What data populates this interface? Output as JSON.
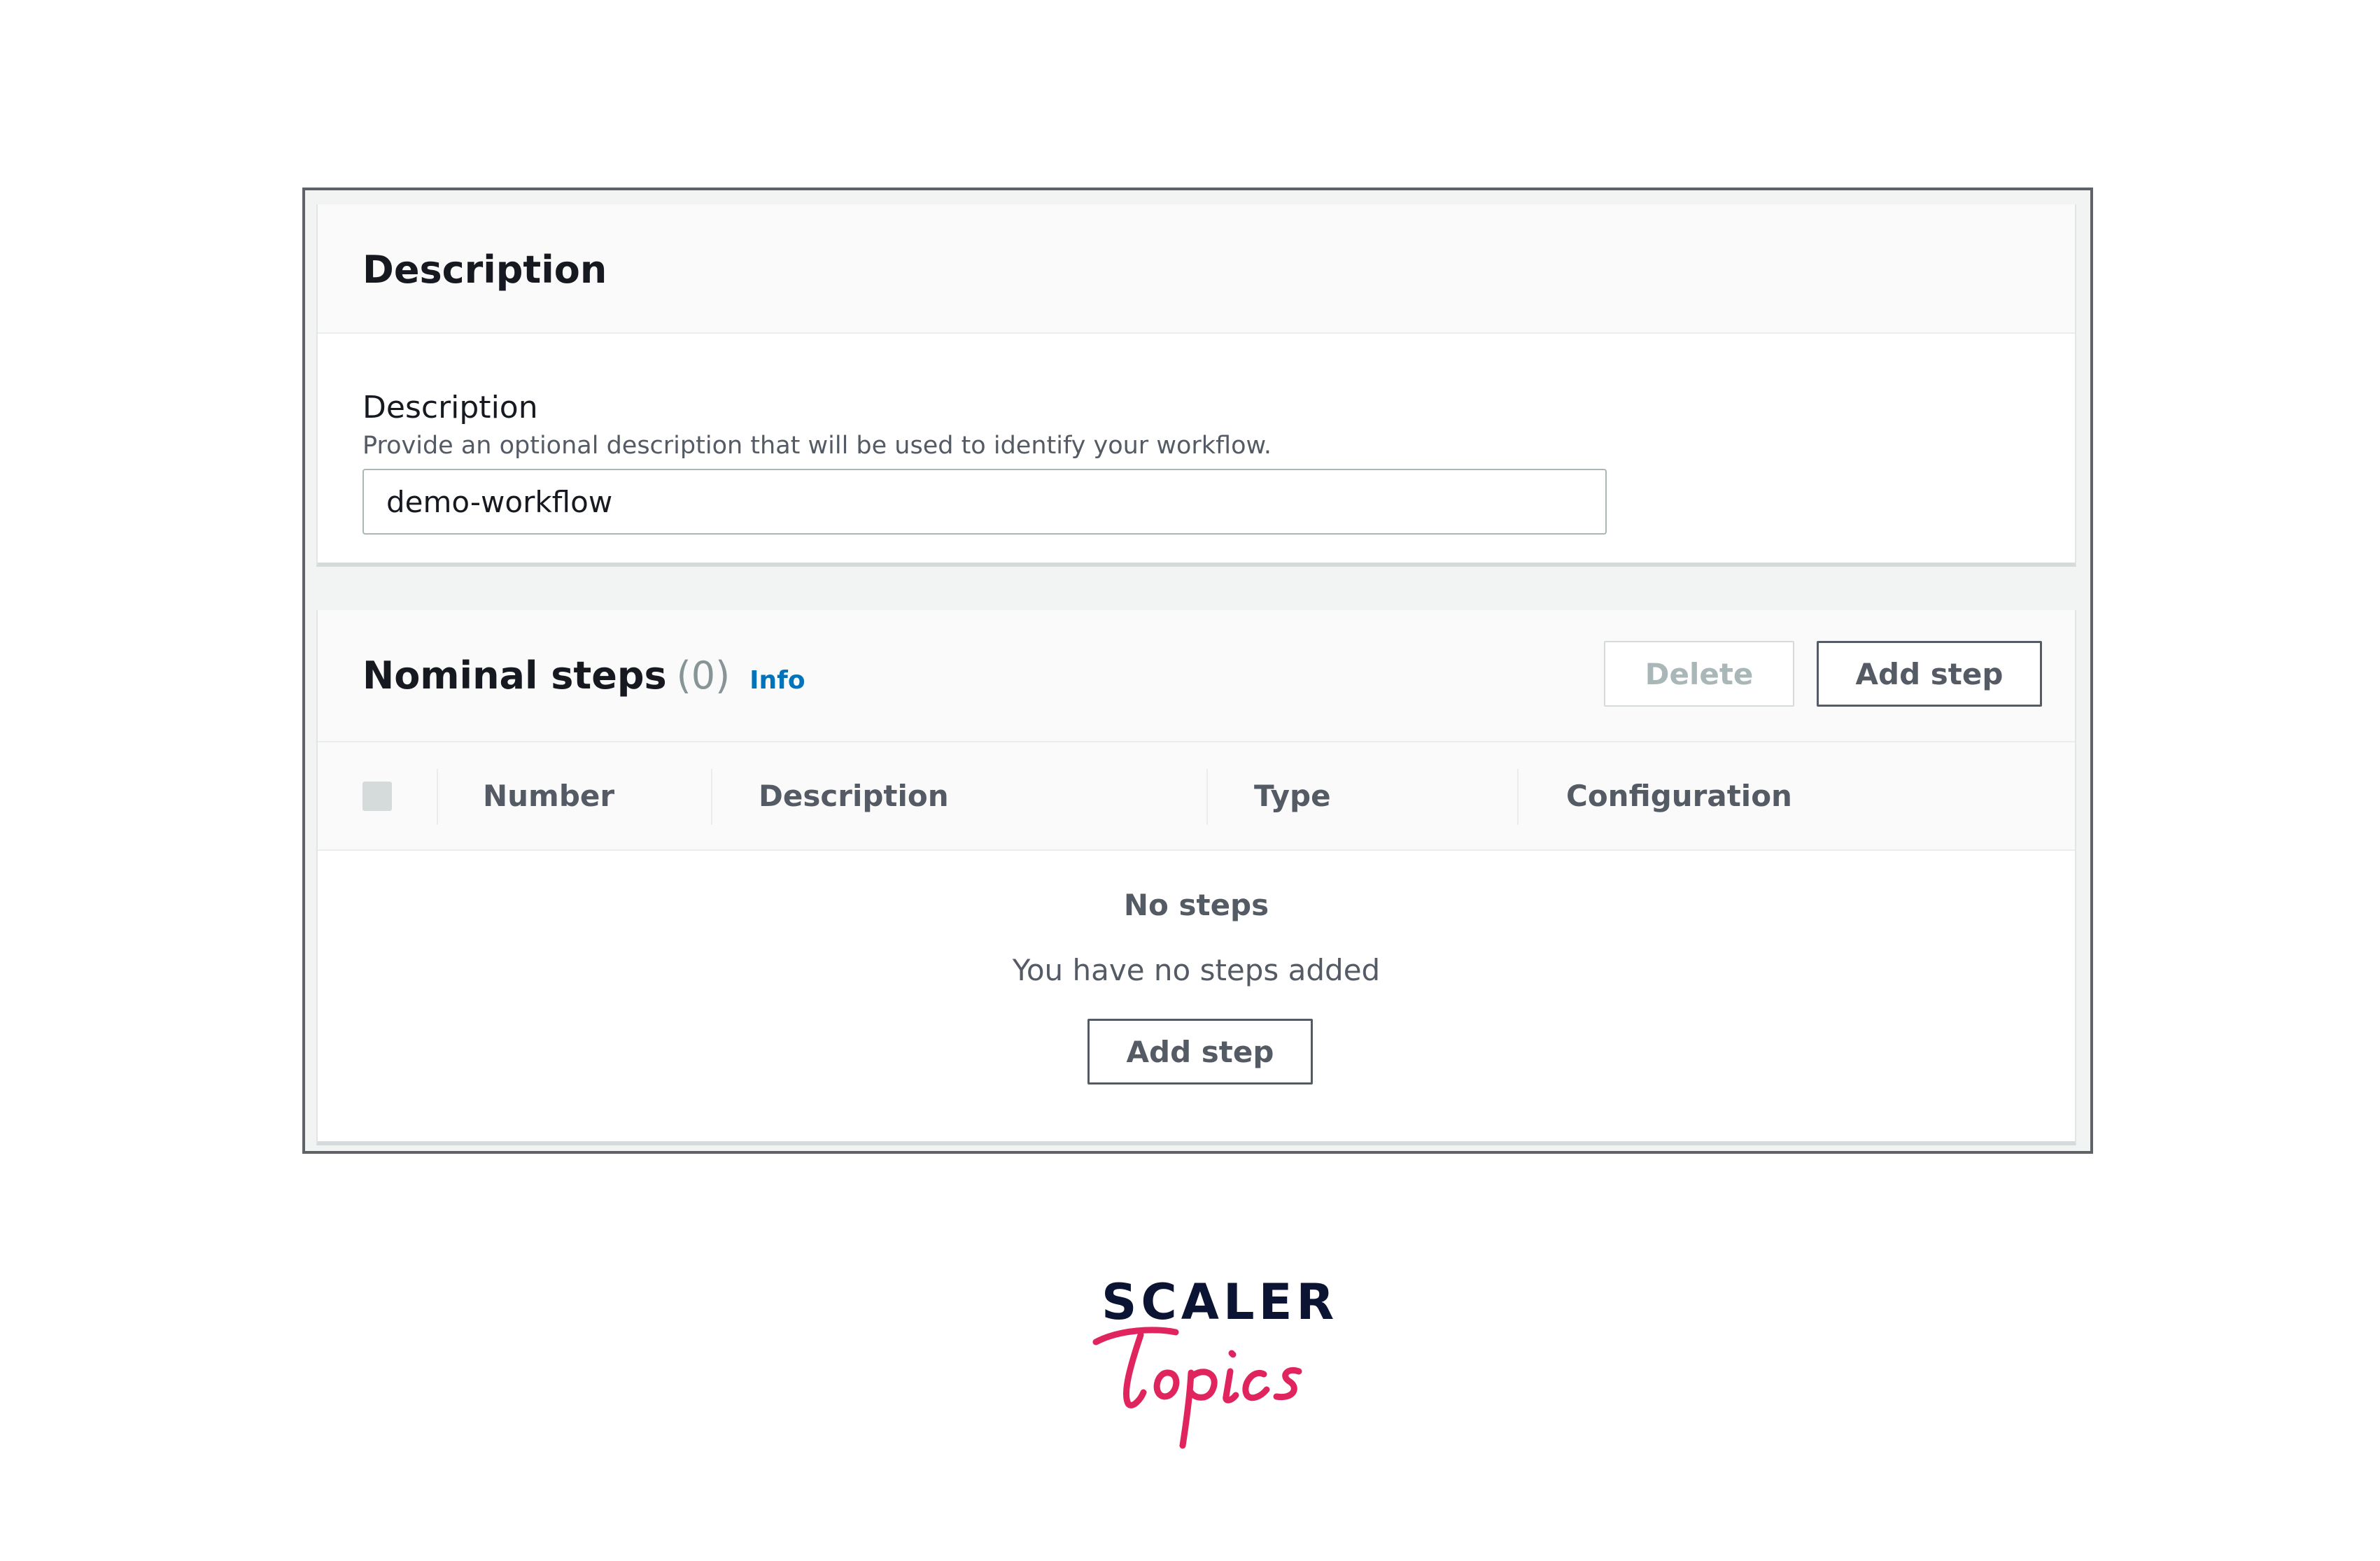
{
  "description_panel": {
    "title": "Description",
    "field_label": "Description",
    "field_hint": "Provide an optional description that will be used to identify your workflow.",
    "field_value": "demo-workflow"
  },
  "steps_panel": {
    "title": "Nominal steps",
    "count": "(0)",
    "info_link": "Info",
    "delete_button": "Delete",
    "add_step_button": "Add step",
    "columns": [
      "Number",
      "Description",
      "Type",
      "Configuration"
    ],
    "empty_title": "No steps",
    "empty_message": "You have no steps added",
    "empty_add_step_button": "Add step"
  },
  "logo": {
    "word": "SCALER",
    "script": "Topics",
    "word_color": "#0b1533",
    "script_color": "#e0245e"
  }
}
